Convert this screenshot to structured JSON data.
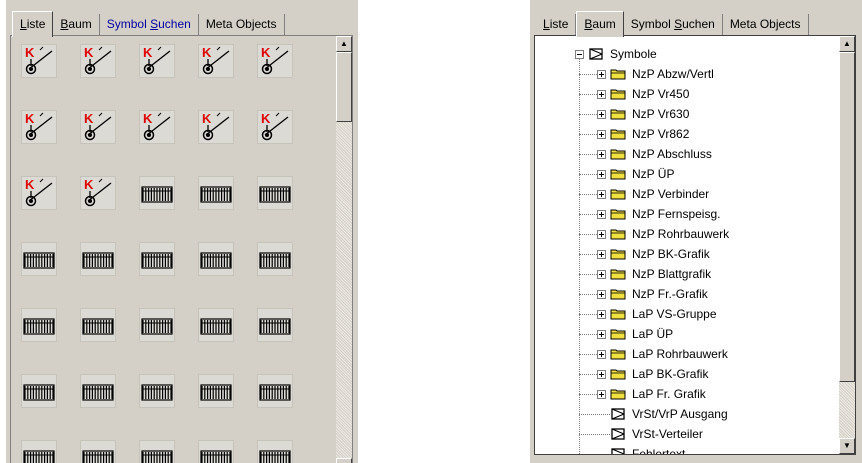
{
  "left": {
    "tabs": [
      {
        "text": "Liste",
        "underline": "L",
        "rest": "iste",
        "active": true
      },
      {
        "text": "Baum",
        "underline": "B",
        "rest": "aum",
        "active": false
      },
      {
        "text": "Symbol Suchen",
        "pre": "Symbol ",
        "underline": "S",
        "rest": "uchen",
        "active": false,
        "blue": true
      },
      {
        "text": "Meta Objects",
        "active": false
      }
    ],
    "symbol_grid": {
      "columns": 5,
      "cells": [
        "valve-k",
        "valve-k",
        "valve-k",
        "valve-k",
        "valve-k",
        "valve-k",
        "valve-k",
        "valve-k",
        "valve-k",
        "valve-k",
        "valve-k",
        "valve-k",
        "rack",
        "rack",
        "rack",
        "rack",
        "rack",
        "rack",
        "rack",
        "rack",
        "rack",
        "rack",
        "rack",
        "rack",
        "rack",
        "rack",
        "rack",
        "rack",
        "rack",
        "rack",
        "rack",
        "rack",
        "rack",
        "rack",
        "rack"
      ]
    }
  },
  "right": {
    "tabs": [
      {
        "text": "Liste",
        "underline": "L",
        "rest": "iste",
        "active": false
      },
      {
        "text": "Baum",
        "underline": "B",
        "rest": "aum",
        "active": true
      },
      {
        "text": "Symbol Suchen",
        "pre": "Symbol ",
        "underline": "S",
        "rest": "uchen",
        "active": false
      },
      {
        "text": "Meta Objects",
        "active": false
      }
    ],
    "tree": {
      "root": "Symbole",
      "folders": [
        "NzP Abzw/Vertl",
        "NzP Vr450",
        "NzP Vr630",
        "NzP Vr862",
        "NzP Abschluss",
        "NzP ÜP",
        "NzP Verbinder",
        "NzP Fernspeisg.",
        "NzP Rohrbauwerk",
        "NzP BK-Grafik",
        "NzP Blattgrafik",
        "NzP Fr.-Grafik",
        "LaP VS-Gruppe",
        "LaP ÜP",
        "LaP Rohrbauwerk",
        "LaP BK-Grafik",
        "LaP Fr. Grafik"
      ],
      "leaves": [
        "VrSt/VrP Ausgang",
        "VrSt-Verteiler",
        "Fehlertext"
      ]
    }
  },
  "colors": {
    "face": "#d4d0c8",
    "folder": "#f0e040",
    "k_red": "#e00000",
    "tab_blue": "#0000a0"
  }
}
